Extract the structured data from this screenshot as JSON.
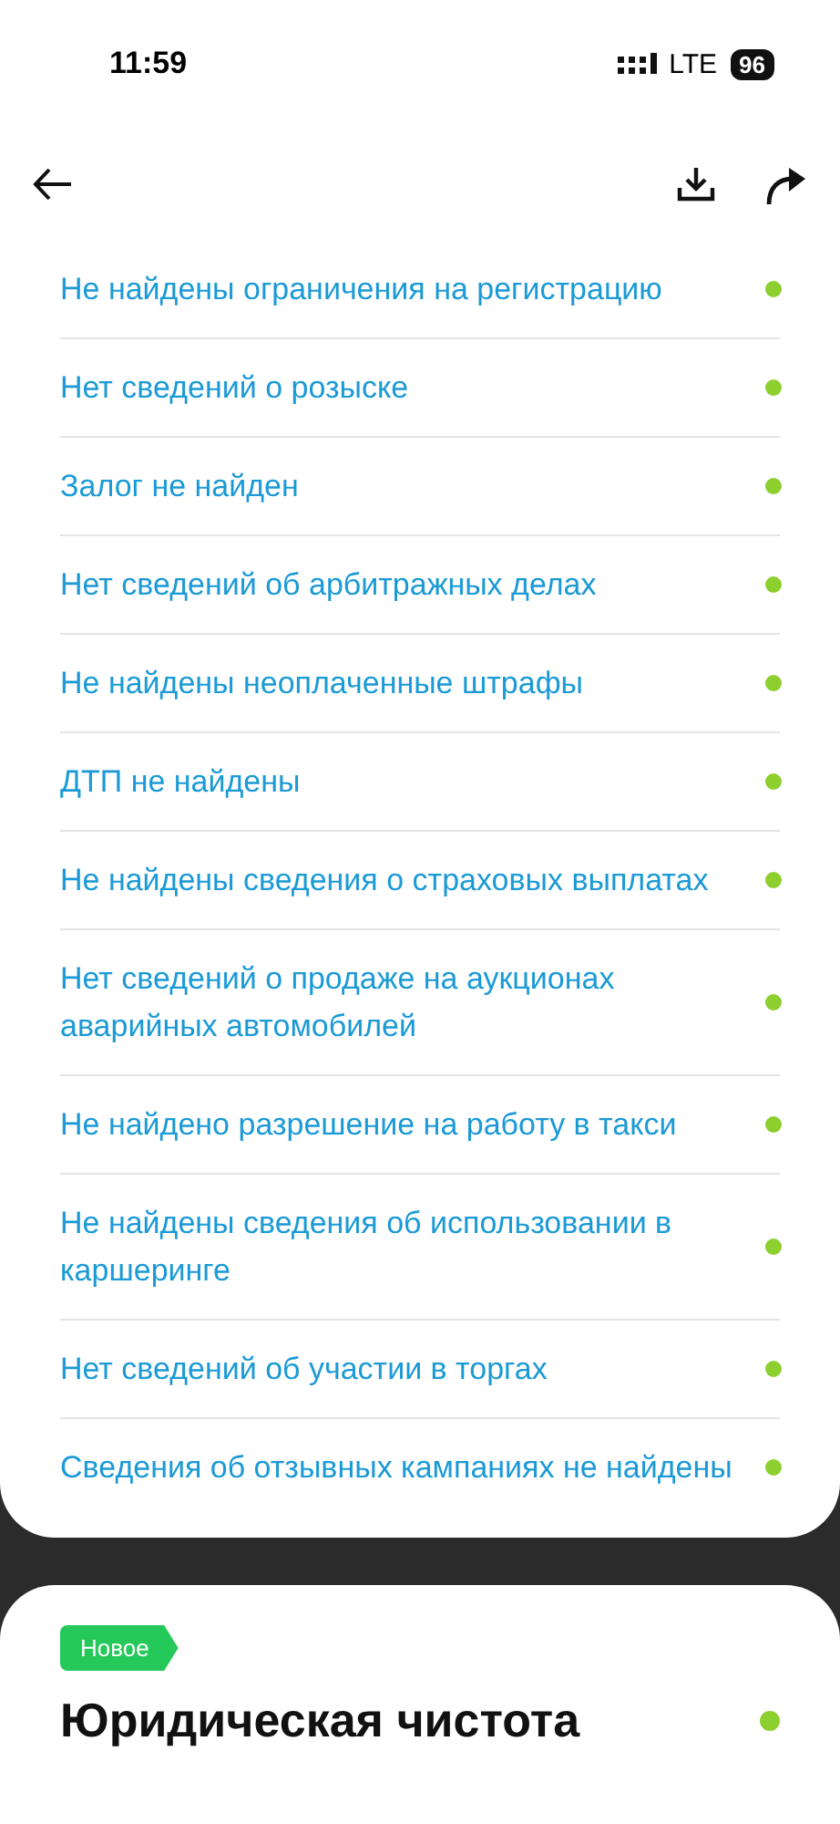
{
  "status_bar": {
    "time": "11:59",
    "network": "LTE",
    "battery": "96"
  },
  "checks": [
    {
      "text": "Не найдены ограничения на регистрацию",
      "passed": true
    },
    {
      "text": "Нет сведений о розыске",
      "passed": true
    },
    {
      "text": "Залог не найден",
      "passed": true
    },
    {
      "text": "Нет сведений об арбитражных делах",
      "passed": true
    },
    {
      "text": "Не найдены неоплаченные штрафы",
      "passed": true
    },
    {
      "text": "ДТП не найдены",
      "passed": true
    },
    {
      "text": "Не найдены сведения о страховых выплатах",
      "passed": true
    },
    {
      "text": "Нет сведений о продаже на аукционах аварийных автомобилей",
      "passed": true
    },
    {
      "text": "Не найдено разрешение на работу в такси",
      "passed": true
    },
    {
      "text": "Не найдены сведения об использовании в каршеринге",
      "passed": true
    },
    {
      "text": "Нет сведений об участии в торгах",
      "passed": true
    },
    {
      "text": "Сведения об отзывных кампаниях не найдены",
      "passed": true
    }
  ],
  "section": {
    "badge": "Новое",
    "title": "Юридическая чистота",
    "passed": true
  }
}
